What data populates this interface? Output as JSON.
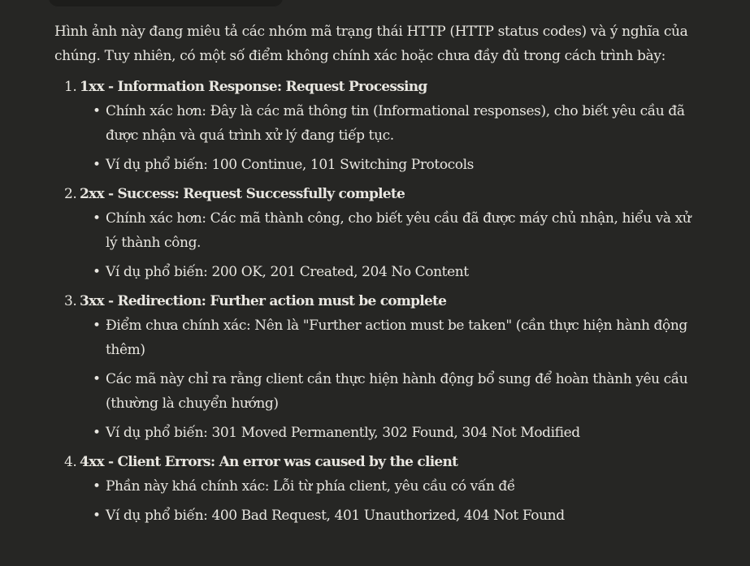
{
  "intro": "Hình ảnh này đang miêu tả các nhóm mã trạng thái HTTP (HTTP status codes) và ý nghĩa của chúng. Tuy nhiên, có một số điểm không chính xác hoặc chưa đầy đủ trong cách trình bày:",
  "sections": [
    {
      "number": "1.",
      "heading": "1xx - Information Response: Request Processing",
      "bullets": [
        "Chính xác hơn: Đây là các mã thông tin (Informational responses), cho biết yêu cầu đã được nhận và quá trình xử lý đang tiếp tục.",
        "Ví dụ phổ biến: 100 Continue, 101 Switching Protocols"
      ]
    },
    {
      "number": "2.",
      "heading": "2xx - Success: Request Successfully complete",
      "bullets": [
        "Chính xác hơn: Các mã thành công, cho biết yêu cầu đã được máy chủ nhận, hiểu và xử lý thành công.",
        "Ví dụ phổ biến: 200 OK, 201 Created, 204 No Content"
      ]
    },
    {
      "number": "3.",
      "heading": "3xx - Redirection: Further action must be complete",
      "bullets": [
        "Điểm chưa chính xác: Nên là \"Further action must be taken\" (cần thực hiện hành động thêm)",
        "Các mã này chỉ ra rằng client cần thực hiện hành động bổ sung để hoàn thành yêu cầu (thường là chuyển hướng)",
        "Ví dụ phổ biến: 301 Moved Permanently, 302 Found, 304 Not Modified"
      ]
    },
    {
      "number": "4.",
      "heading": "4xx - Client Errors: An error was caused by the client",
      "bullets": [
        "Phần này khá chính xác: Lỗi từ phía client, yêu cầu có vấn đề",
        "Ví dụ phổ biến: 400 Bad Request, 401 Unauthorized, 404 Not Found"
      ]
    }
  ]
}
